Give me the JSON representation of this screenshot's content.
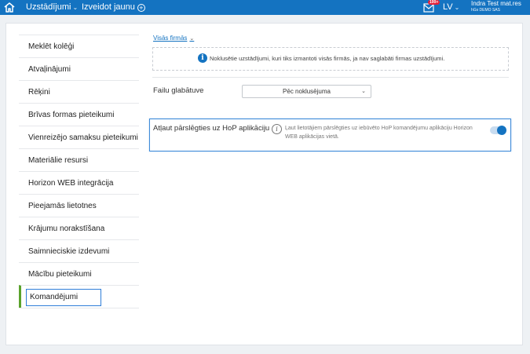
{
  "topbar": {
    "menu_settings": "Uzstādījumi",
    "menu_create": "Izveidot jaunu",
    "notifications_badge": "100+",
    "language": "LV",
    "user_name": "Indra Test mat.res",
    "user_company": "hGs DEMO SAS",
    "bar_color": "#1473c1"
  },
  "sidebar": {
    "items": [
      {
        "label": "Meklēt kolēģi"
      },
      {
        "label": "Atvaļinājumi"
      },
      {
        "label": "Rēķini"
      },
      {
        "label": "Brīvas formas pieteikumi"
      },
      {
        "label": "Vienreizējo samaksu pieteikumi"
      },
      {
        "label": "Materiālie resursi"
      },
      {
        "label": "Horizon WEB integrācija"
      },
      {
        "label": "Pieejamās lietotnes"
      },
      {
        "label": "Krājumu norakstīšana"
      },
      {
        "label": "Saimnieciskie izdevumi"
      },
      {
        "label": "Mācību pieteikumi"
      },
      {
        "label": "Komandējumi"
      }
    ],
    "active_index": 11
  },
  "main": {
    "scope_link": "Visās firmās",
    "info_text": "Noklusētie uzstādījumi, kuri tiks izmantoti visās firmās, ja nav saglabāti firmas uzstādījumi.",
    "storage_label": "Failu glabātuve",
    "storage_value": "Pēc noklusējuma",
    "setting_label": "Atļaut pārslēgties uz HoP aplikāciju",
    "setting_help": "Ļaut lietotājiem pārslēgties uz iebūvēto HoP komandējumu aplikāciju Horizon WEB aplikācijas vietā.",
    "toggle_on": true
  }
}
